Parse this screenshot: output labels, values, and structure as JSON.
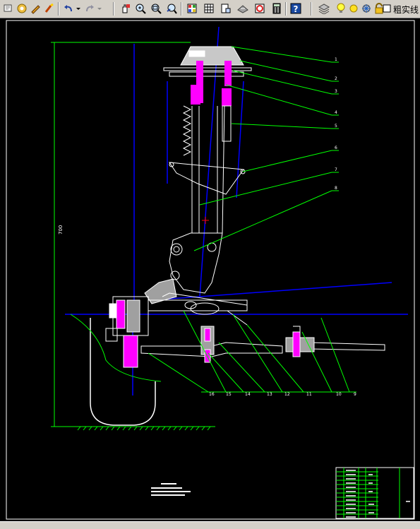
{
  "toolbar": {
    "buttons": [
      {
        "name": "select-icon"
      },
      {
        "name": "open-icon"
      },
      {
        "name": "pencil-icon"
      },
      {
        "name": "brush-icon"
      },
      {
        "name": "undo-icon"
      },
      {
        "name": "redo-icon"
      },
      {
        "name": "pan-icon"
      },
      {
        "name": "zoom-realtime-icon"
      },
      {
        "name": "zoom-window-icon"
      },
      {
        "name": "zoom-previous-icon"
      },
      {
        "name": "properties-icon"
      },
      {
        "name": "grid-icon"
      },
      {
        "name": "design-center-icon"
      },
      {
        "name": "tool-palette-icon"
      },
      {
        "name": "markup-icon"
      },
      {
        "name": "calculator-icon"
      },
      {
        "name": "help-icon"
      },
      {
        "name": "layers-icon"
      },
      {
        "name": "bulb-icon"
      },
      {
        "name": "sun-icon"
      },
      {
        "name": "freeze-icon"
      },
      {
        "name": "lock-icon"
      }
    ],
    "lineweight_label": "粗实线"
  },
  "drawing": {
    "callouts": [
      "1",
      "2",
      "3",
      "4",
      "5",
      "6",
      "7",
      "8",
      "9",
      "10",
      "11",
      "12",
      "13",
      "14",
      "15",
      "16"
    ],
    "dimension_label": "700",
    "colors": {
      "background": "#000000",
      "outline": "#ffffff",
      "leader": "#00ff00",
      "centerline": "#0000ff",
      "magenta": "#ff00ff"
    }
  }
}
